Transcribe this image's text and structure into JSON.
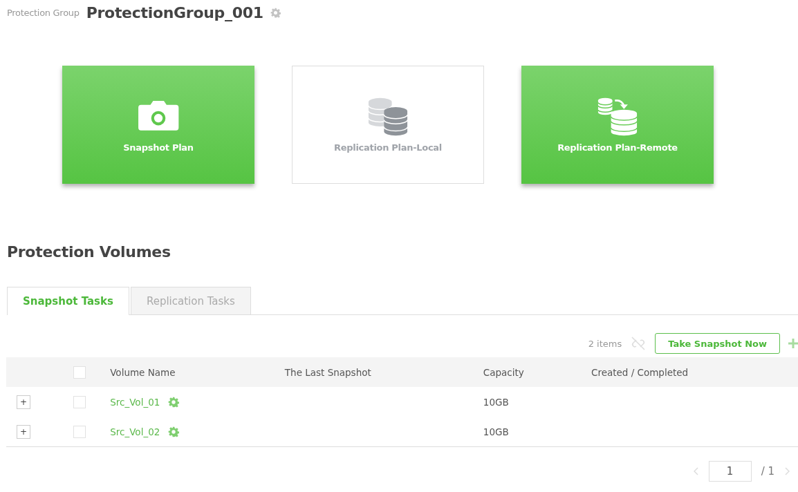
{
  "header": {
    "label": "Protection Group",
    "title": "ProtectionGroup_001"
  },
  "plans": [
    {
      "label": "Snapshot Plan",
      "kind": "camera",
      "active": true
    },
    {
      "label": "Replication Plan-Local",
      "kind": "local",
      "active": false
    },
    {
      "label": "Replication Plan-Remote",
      "kind": "remote",
      "active": true
    }
  ],
  "section_title": "Protection Volumes",
  "tabs": [
    {
      "label": "Snapshot Tasks",
      "selected": true
    },
    {
      "label": "Replication Tasks",
      "selected": false
    }
  ],
  "toolbar": {
    "count": "2 items",
    "action": "Take Snapshot Now"
  },
  "table": {
    "columns": [
      "Volume Name",
      "The Last Snapshot",
      "Capacity",
      "Created / Completed"
    ],
    "header_checked": false,
    "rows": [
      {
        "expand": "+",
        "checked": false,
        "name": "Src_Vol_01",
        "capacity": "10GB"
      },
      {
        "expand": "+",
        "checked": false,
        "name": "Src_Vol_02",
        "capacity": "10GB"
      }
    ]
  },
  "pagination": {
    "page": "1",
    "total": "/ 1"
  }
}
